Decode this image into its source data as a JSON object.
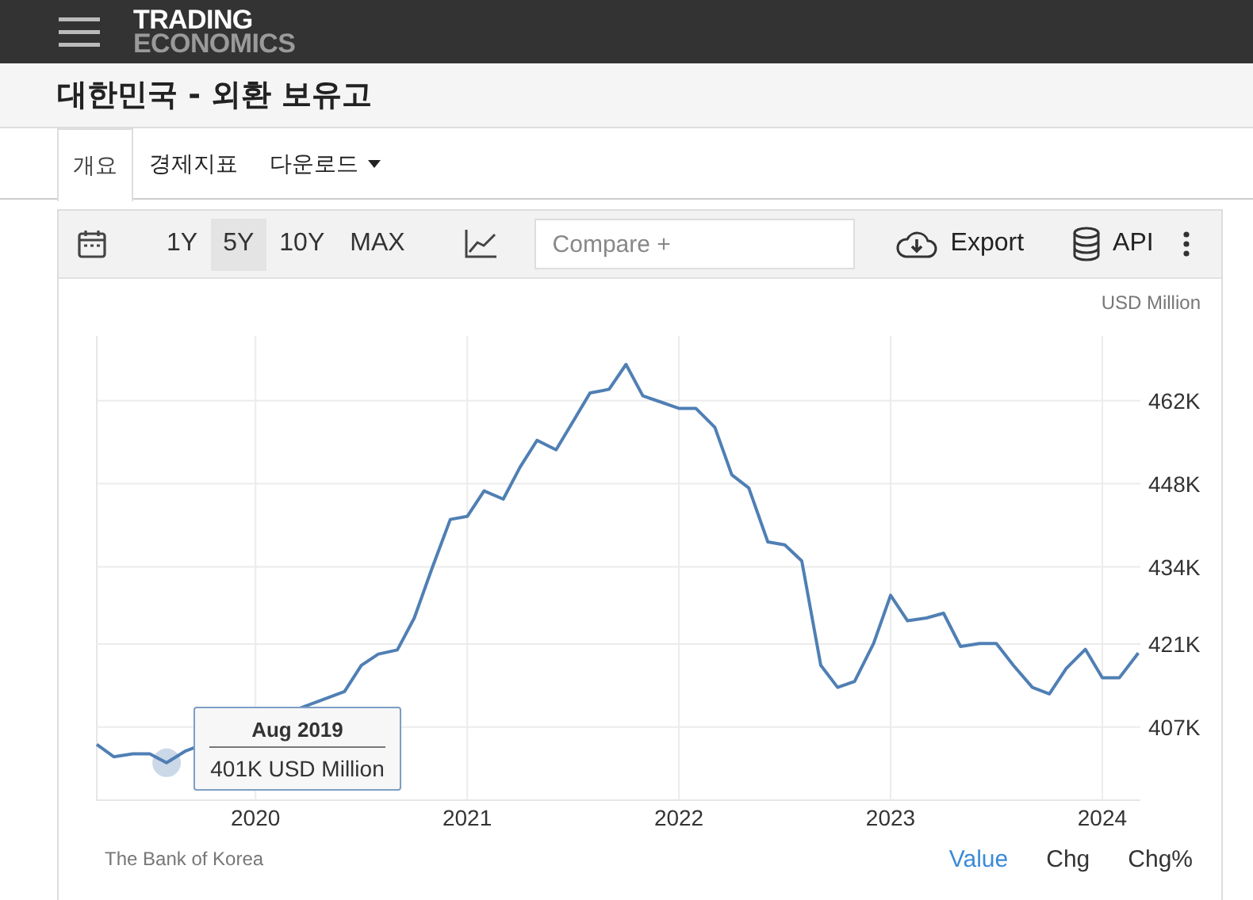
{
  "header": {
    "logo_top": "TRADING",
    "logo_bottom": "ECONOMICS"
  },
  "title": "대한민국 - 외환 보유고",
  "tabs": [
    {
      "label": "개요",
      "selected": true,
      "dropdown": false
    },
    {
      "label": "경제지표",
      "selected": false,
      "dropdown": false
    },
    {
      "label": "다운로드",
      "selected": false,
      "dropdown": true
    }
  ],
  "toolbar": {
    "ranges": [
      {
        "label": "1Y",
        "selected": false
      },
      {
        "label": "5Y",
        "selected": true
      },
      {
        "label": "10Y",
        "selected": false
      },
      {
        "label": "MAX",
        "selected": false
      }
    ],
    "compare": {
      "placeholder": "Compare +"
    },
    "export": "Export",
    "api": "API"
  },
  "chart": {
    "unit": "USD Million",
    "chart_data": {
      "type": "line",
      "grid": true,
      "xlim": [
        2019.25,
        2024.18
      ],
      "ylim": [
        394.7,
        472.9
      ],
      "xticks": [
        2020,
        2021,
        2022,
        2023,
        2024
      ],
      "yticks": [
        {
          "value": 407,
          "label": "407K"
        },
        {
          "value": 421,
          "label": "421K"
        },
        {
          "value": 434,
          "label": "434K"
        },
        {
          "value": 448,
          "label": "448K"
        },
        {
          "value": 462,
          "label": "462K"
        }
      ],
      "x": [
        2019.25,
        2019.33,
        2019.42,
        2019.5,
        2019.58,
        2019.67,
        2019.75,
        2019.83,
        2019.92,
        2020.0,
        2020.08,
        2020.17,
        2020.25,
        2020.33,
        2020.42,
        2020.5,
        2020.58,
        2020.67,
        2020.75,
        2020.83,
        2020.92,
        2021.0,
        2021.08,
        2021.17,
        2021.25,
        2021.33,
        2021.42,
        2021.5,
        2021.58,
        2021.67,
        2021.75,
        2021.83,
        2021.92,
        2022.0,
        2022.08,
        2022.17,
        2022.25,
        2022.33,
        2022.42,
        2022.5,
        2022.58,
        2022.67,
        2022.75,
        2022.83,
        2022.92,
        2023.0,
        2023.08,
        2023.17,
        2023.25,
        2023.33,
        2023.42,
        2023.5,
        2023.58,
        2023.67,
        2023.75,
        2023.83,
        2023.92,
        2024.0,
        2024.08,
        2024.17
      ],
      "series": [
        {
          "color": "#4f7fb4",
          "values": [
            404.1,
            402,
            402.5,
            402.5,
            401,
            403,
            null,
            null,
            null,
            null,
            null,
            null,
            null,
            null,
            413,
            417.4,
            419.3,
            420,
            425.4,
            433.4,
            442,
            442.5,
            446.8,
            445.4,
            450.8,
            455.3,
            453.7,
            458.5,
            463.3,
            463.9,
            468.1,
            462.8,
            461.7,
            460.7,
            460.7,
            457.5,
            449.5,
            447.3,
            438.2,
            437.7,
            435,
            417.4,
            413.7,
            414.7,
            421.1,
            429.2,
            424.9,
            425.4,
            426.2,
            420.6,
            421.1,
            421.1,
            417.4,
            413.7,
            412.6,
            416.9,
            420.1,
            415.3,
            415.3,
            419.5
          ]
        }
      ]
    },
    "tooltip": {
      "title": "Aug 2019",
      "text": "401K USD Million"
    },
    "source": "The Bank of Korea",
    "views": [
      {
        "label": "Value",
        "selected": true
      },
      {
        "label": "Chg",
        "selected": false
      },
      {
        "label": "Chg%",
        "selected": false
      }
    ]
  }
}
